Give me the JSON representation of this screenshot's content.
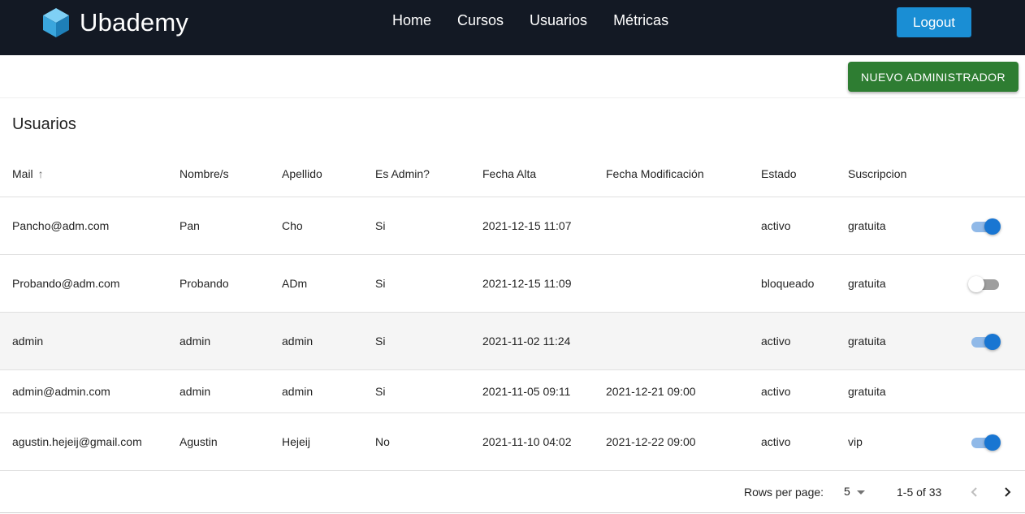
{
  "navbar": {
    "brand": "Ubademy",
    "links": [
      "Home",
      "Cursos",
      "Usuarios",
      "Métricas"
    ],
    "logout_label": "Logout",
    "colors": {
      "background": "#131924",
      "logout": "#1a8ed4"
    }
  },
  "actions": {
    "new_admin_label": "NUEVO ADMINISTRADOR",
    "color": "#2e7d32"
  },
  "table": {
    "title": "Usuarios",
    "columns": [
      "Mail",
      "Nombre/s",
      "Apellido",
      "Es Admin?",
      "Fecha Alta",
      "Fecha Modificación",
      "Estado",
      "Suscripcion"
    ],
    "sort": {
      "column": "Mail",
      "direction": "asc",
      "icon": "arrow-up-icon"
    },
    "rows": [
      {
        "mail": "Pancho@adm.com",
        "nombre": "Pan",
        "apellido": "Cho",
        "admin": "Si",
        "alta": "2021-12-15 11:07",
        "modificacion": "",
        "estado": "activo",
        "suscripcion": "gratuita",
        "toggle": "on"
      },
      {
        "mail": "Probando@adm.com",
        "nombre": "Probando",
        "apellido": "ADm",
        "admin": "Si",
        "alta": "2021-12-15 11:09",
        "modificacion": "",
        "estado": "bloqueado",
        "suscripcion": "gratuita",
        "toggle": "off"
      },
      {
        "mail": "admin",
        "nombre": "admin",
        "apellido": "admin",
        "admin": "Si",
        "alta": "2021-11-02 11:24",
        "modificacion": "",
        "estado": "activo",
        "suscripcion": "gratuita",
        "toggle": "on"
      },
      {
        "mail": "admin@admin.com",
        "nombre": "admin",
        "apellido": "admin",
        "admin": "Si",
        "alta": "2021-11-05 09:11",
        "modificacion": "2021-12-21 09:00",
        "estado": "activo",
        "suscripcion": "gratuita",
        "toggle": "none"
      },
      {
        "mail": "agustin.hejeij@gmail.com",
        "nombre": "Agustin",
        "apellido": "Hejeij",
        "admin": "No",
        "alta": "2021-11-10 04:02",
        "modificacion": "2021-12-22 09:00",
        "estado": "activo",
        "suscripcion": "vip",
        "toggle": "on"
      }
    ],
    "toggle_colors": {
      "on_thumb": "#1976d2",
      "on_track": "#90b9e8",
      "off_track": "#9e9e9e"
    }
  },
  "pagination": {
    "rows_per_page_label": "Rows per page:",
    "rows_per_page_value": "5",
    "range_label": "1-5 of 33"
  }
}
